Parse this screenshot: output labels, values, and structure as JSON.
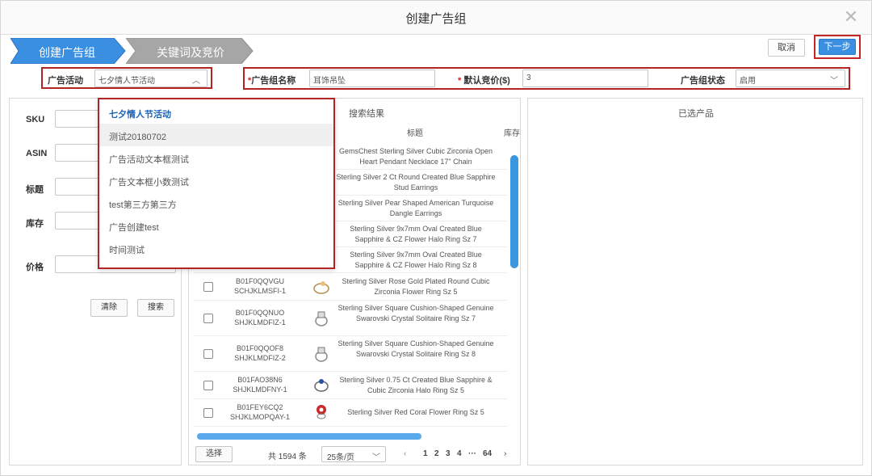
{
  "dialog": {
    "title": "创建广告组"
  },
  "steps": [
    {
      "label": "创建广告组",
      "active": true
    },
    {
      "label": "关键词及竞价",
      "active": false
    }
  ],
  "toolbar": {
    "cancel_label": "取消",
    "next_label": "下一步"
  },
  "form_bar": {
    "campaign_label": "广告活动",
    "campaign_value": "七夕情人节活动",
    "group_name_label": "广告组名称",
    "group_name_value": "耳饰吊坠",
    "default_bid_label": "默认竞价($)",
    "default_bid_value": "3",
    "status_label": "广告组状态",
    "status_value": "启用",
    "required_mark": "*"
  },
  "dropdown": {
    "items": [
      "七夕情人节活动",
      "测试20180702",
      "广告活动文本框测试",
      "广告文本框小数测试",
      "test第三方第三方",
      "广告创建test",
      "时间测试"
    ]
  },
  "filters": {
    "sku_label": "SKU",
    "asin_label": "ASIN",
    "title_label": "标题",
    "stock_label": "库存",
    "price_label": "价格",
    "clear_label": "清除",
    "search_label": "搜索"
  },
  "results": {
    "caption": "搜索结果",
    "col_title": "标题",
    "col_stock": "库存",
    "rows": [
      {
        "asin": "",
        "title": "GemsChest Sterling Silver Cubic Zirconia Open Heart Pendant Necklace 17\" Chain"
      },
      {
        "asin": "",
        "title": "Sterling Silver 2 Ct Round Created Blue Sapphire Stud Earrings"
      },
      {
        "asin": "",
        "title": "Sterling Silver Pear Shaped American Turquoise Dangle Earrings"
      },
      {
        "asin": "",
        "title": "Sterling Silver 9x7mm Oval Created Blue Sapphire & CZ Flower Halo Ring Sz 7"
      },
      {
        "asin": "",
        "title": "Sterling Silver 9x7mm Oval Created Blue Sapphire & CZ Flower Halo Ring Sz 8"
      },
      {
        "asin": "B01F0QQVGU SCHJKLMSFI-1",
        "title": "Sterling Silver Rose Gold Plated Round Cubic Zirconia Flower Ring Sz 5"
      },
      {
        "asin": "B01F0QQNUO SHJKLMDFIZ-1",
        "title": "Sterling Silver Square Cushion-Shaped Genuine Swarovski Crystal Solitaire Ring Sz 7"
      },
      {
        "asin": "B01F0QQOF8 SHJKLMDFIZ-2",
        "title": "Sterling Silver Square Cushion-Shaped Genuine Swarovski Crystal Solitaire Ring Sz 8"
      },
      {
        "asin": "B01FAO38N6 SHJKLMDFNY-1",
        "title": "Sterling Silver 0.75 Ct Created Blue Sapphire & Cubic Zirconia Halo Ring Sz 5"
      },
      {
        "asin": "B01FEY6CQ2 SHJKLMOPQAY-1",
        "title": "Sterling Silver Red Coral Flower Ring Sz 5"
      }
    ],
    "select_label": "选择",
    "total_label": "共 1594 条",
    "per_page": "25条/页",
    "pages": [
      "1",
      "2",
      "3",
      "4",
      "···",
      "64"
    ],
    "prev_label": "‹",
    "next_label": "›"
  },
  "selected": {
    "caption": "已选产品"
  },
  "colors": {
    "accent": "#3b8fe0",
    "highlight_frame": "#b32525",
    "step_active": "#3b8fe0",
    "step_inactive": "#a6a6a6"
  }
}
